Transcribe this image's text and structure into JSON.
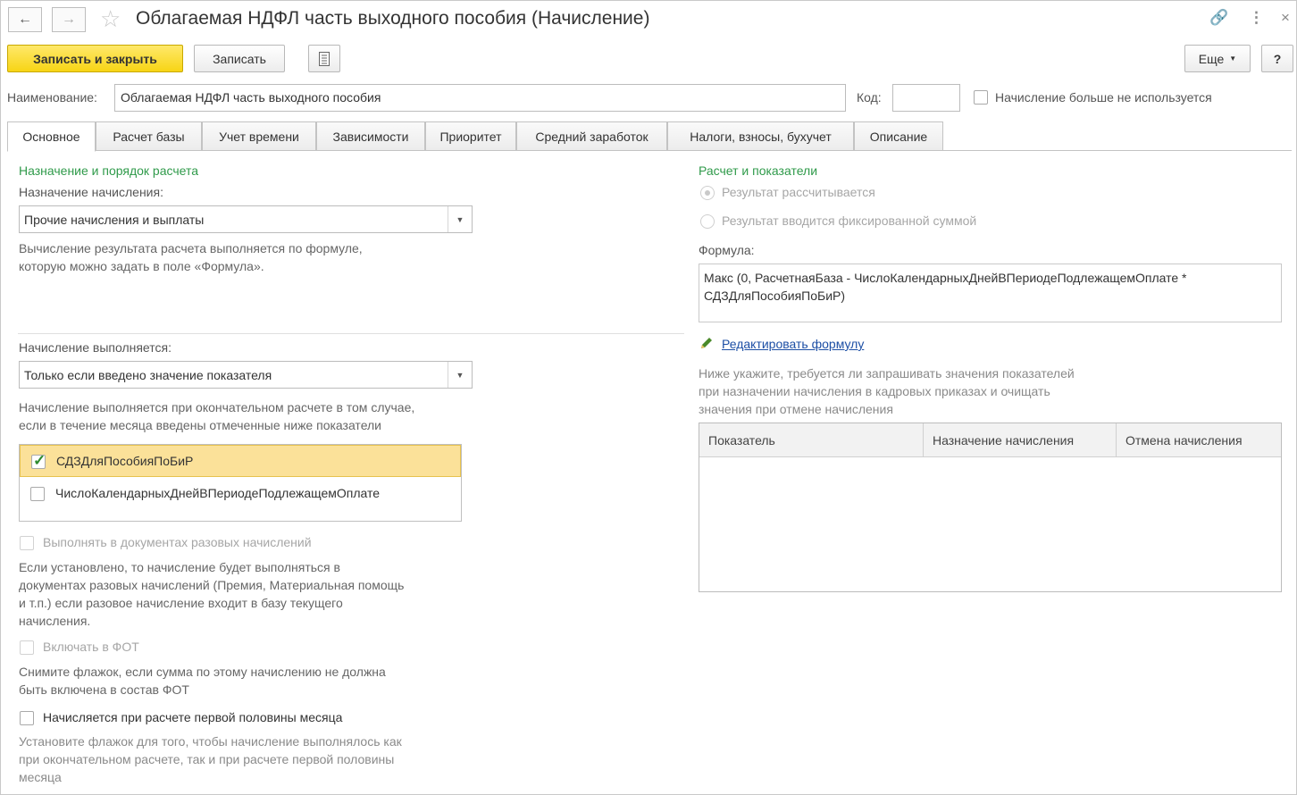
{
  "header": {
    "title": "Облагаемая НДФЛ часть выходного пособия (Начисление)"
  },
  "toolbar": {
    "save_close": "Записать и закрыть",
    "save": "Записать",
    "more": "Еще",
    "help": "?"
  },
  "name_row": {
    "name_label": "Наименование:",
    "name_value": "Облагаемая НДФЛ часть выходного пособия",
    "code_label": "Код:",
    "code_value": "",
    "unused_label": "Начисление больше не используется"
  },
  "tabs": [
    {
      "label": "Основное",
      "active": true
    },
    {
      "label": "Расчет базы"
    },
    {
      "label": "Учет времени"
    },
    {
      "label": "Зависимости"
    },
    {
      "label": "Приоритет"
    },
    {
      "label": "Средний заработок"
    },
    {
      "label": "Налоги, взносы, бухучет"
    },
    {
      "label": "Описание"
    }
  ],
  "left": {
    "section_title": "Назначение и порядок расчета",
    "purpose_label": "Назначение начисления:",
    "purpose_value": "Прочие начисления и выплаты",
    "purpose_hint_1": "Вычисление результата расчета выполняется по формуле,",
    "purpose_hint_2": "которую можно задать в поле «Формула».",
    "executes_label": "Начисление выполняется:",
    "executes_value": "Только если введено значение показателя",
    "executes_hint_1": "Начисление выполняется при окончательном расчете в том случае,",
    "executes_hint_2": "если в течение месяца введены отмеченные ниже показатели",
    "indicators": [
      {
        "label": "СДЗДляПособияПоБиР",
        "checked": true
      },
      {
        "label": "ЧислоКалендарныхДнейВПериодеПодлежащемОплате",
        "checked": false
      }
    ],
    "onetime_label": "Выполнять в документах разовых начислений",
    "onetime_hint_1": "Если установлено, то начисление будет выполняться в",
    "onetime_hint_2": "документах разовых начислений (Премия, Материальная помощь",
    "onetime_hint_3": "и т.п.) если разовое начисление входит в базу текущего",
    "onetime_hint_4": "начисления.",
    "fot_label": "Включать в ФОТ",
    "fot_hint_1": "Снимите флажок, если сумма по этому начислению не должна",
    "fot_hint_2": "быть включена в состав ФОТ",
    "half_label": "Начисляется при расчете первой половины месяца",
    "half_hint_1": "Установите флажок для того, чтобы начисление выполнялось как",
    "half_hint_2": "при окончательном расчете, так и при расчете первой половины",
    "half_hint_3": "месяца"
  },
  "right": {
    "section_title": "Расчет и показатели",
    "radio_calculated": "Результат рассчитывается",
    "radio_fixed": "Результат вводится фиксированной суммой",
    "formula_label": "Формула:",
    "formula_line_1": "Макс (0, РасчетнаяБаза - ЧислоКалендарныхДнейВПериодеПодлежащемОплате *",
    "formula_line_2": "СДЗДляПособияПоБиР)",
    "edit_formula_link": "Редактировать формулу",
    "note_1": "Ниже укажите, требуется ли запрашивать значения показателей",
    "note_2": "при назначении начисления в кадровых приказах и очищать",
    "note_3": "значения при отмене начисления",
    "table_columns": [
      "Показатель",
      "Назначение начисления",
      "Отмена начисления"
    ]
  }
}
